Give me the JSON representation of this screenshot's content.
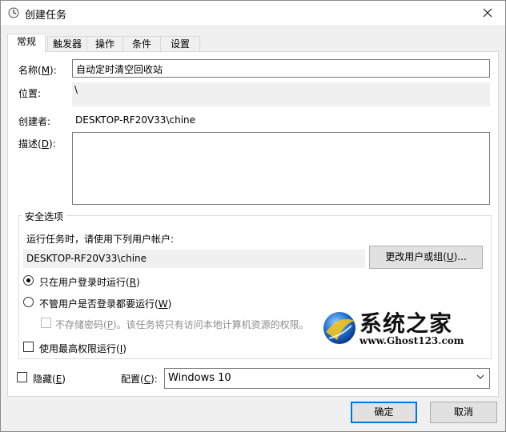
{
  "window": {
    "title": "创建任务",
    "close_glyph": "✕"
  },
  "tabs": [
    {
      "label": "常规",
      "active": true
    },
    {
      "label": "触发器",
      "active": false
    },
    {
      "label": "操作",
      "active": false
    },
    {
      "label": "条件",
      "active": false
    },
    {
      "label": "设置",
      "active": false
    }
  ],
  "general": {
    "name_label": "名称(",
    "name_key": "M",
    "name_label_end": "):",
    "name_value": "自动定时清空回收站",
    "location_label": "位置:",
    "location_value": "\\",
    "author_label": "创建者:",
    "author_value": "DESKTOP-RF20V33\\chine",
    "description_label": "描述(",
    "description_key": "D",
    "description_label_end": "):",
    "description_value": ""
  },
  "security": {
    "group_title": "安全选项",
    "run_as_prompt": "运行任务时，请使用下列用户帐户:",
    "run_as_user": "DESKTOP-RF20V33\\chine",
    "change_user_label": "更改用户或组(",
    "change_user_key": "U",
    "change_user_end": ")...",
    "radio_logged_on_label": "只在用户登录时运行(",
    "radio_logged_on_key": "R",
    "radio_logged_on_end": ")",
    "radio_logged_on_selected": true,
    "radio_any_label": "不管用户是否登录都要运行(",
    "radio_any_key": "W",
    "radio_any_end": ")",
    "radio_any_selected": false,
    "no_store_password_label": "不存储密码(",
    "no_store_password_key": "P",
    "no_store_password_end": ")。该任务将只有访问本地计算机资源的权限。",
    "no_store_password_checked": false,
    "highest_privileges_label": "使用最高权限运行(",
    "highest_privileges_key": "I",
    "highest_privileges_end": ")",
    "highest_privileges_checked": false
  },
  "footer": {
    "hidden_label": "隐藏(",
    "hidden_key": "E",
    "hidden_end": ")",
    "hidden_checked": false,
    "configure_label": "配置(",
    "configure_key": "C",
    "configure_end": "):",
    "configure_value": "Windows 10",
    "ok_label": "确定",
    "cancel_label": "取消"
  },
  "watermark": {
    "title": "系统之家",
    "url": "www.Ghost123.com"
  },
  "icons": {
    "title_icon": "clock-icon",
    "close_icon": "close-icon",
    "dropdown_icon": "chevron-down-icon",
    "watermark_logo": "globe-logo-icon"
  },
  "colors": {
    "accent": "#0078d7",
    "window_bg": "#f0f0f0",
    "panel_bg": "#ffffff"
  }
}
